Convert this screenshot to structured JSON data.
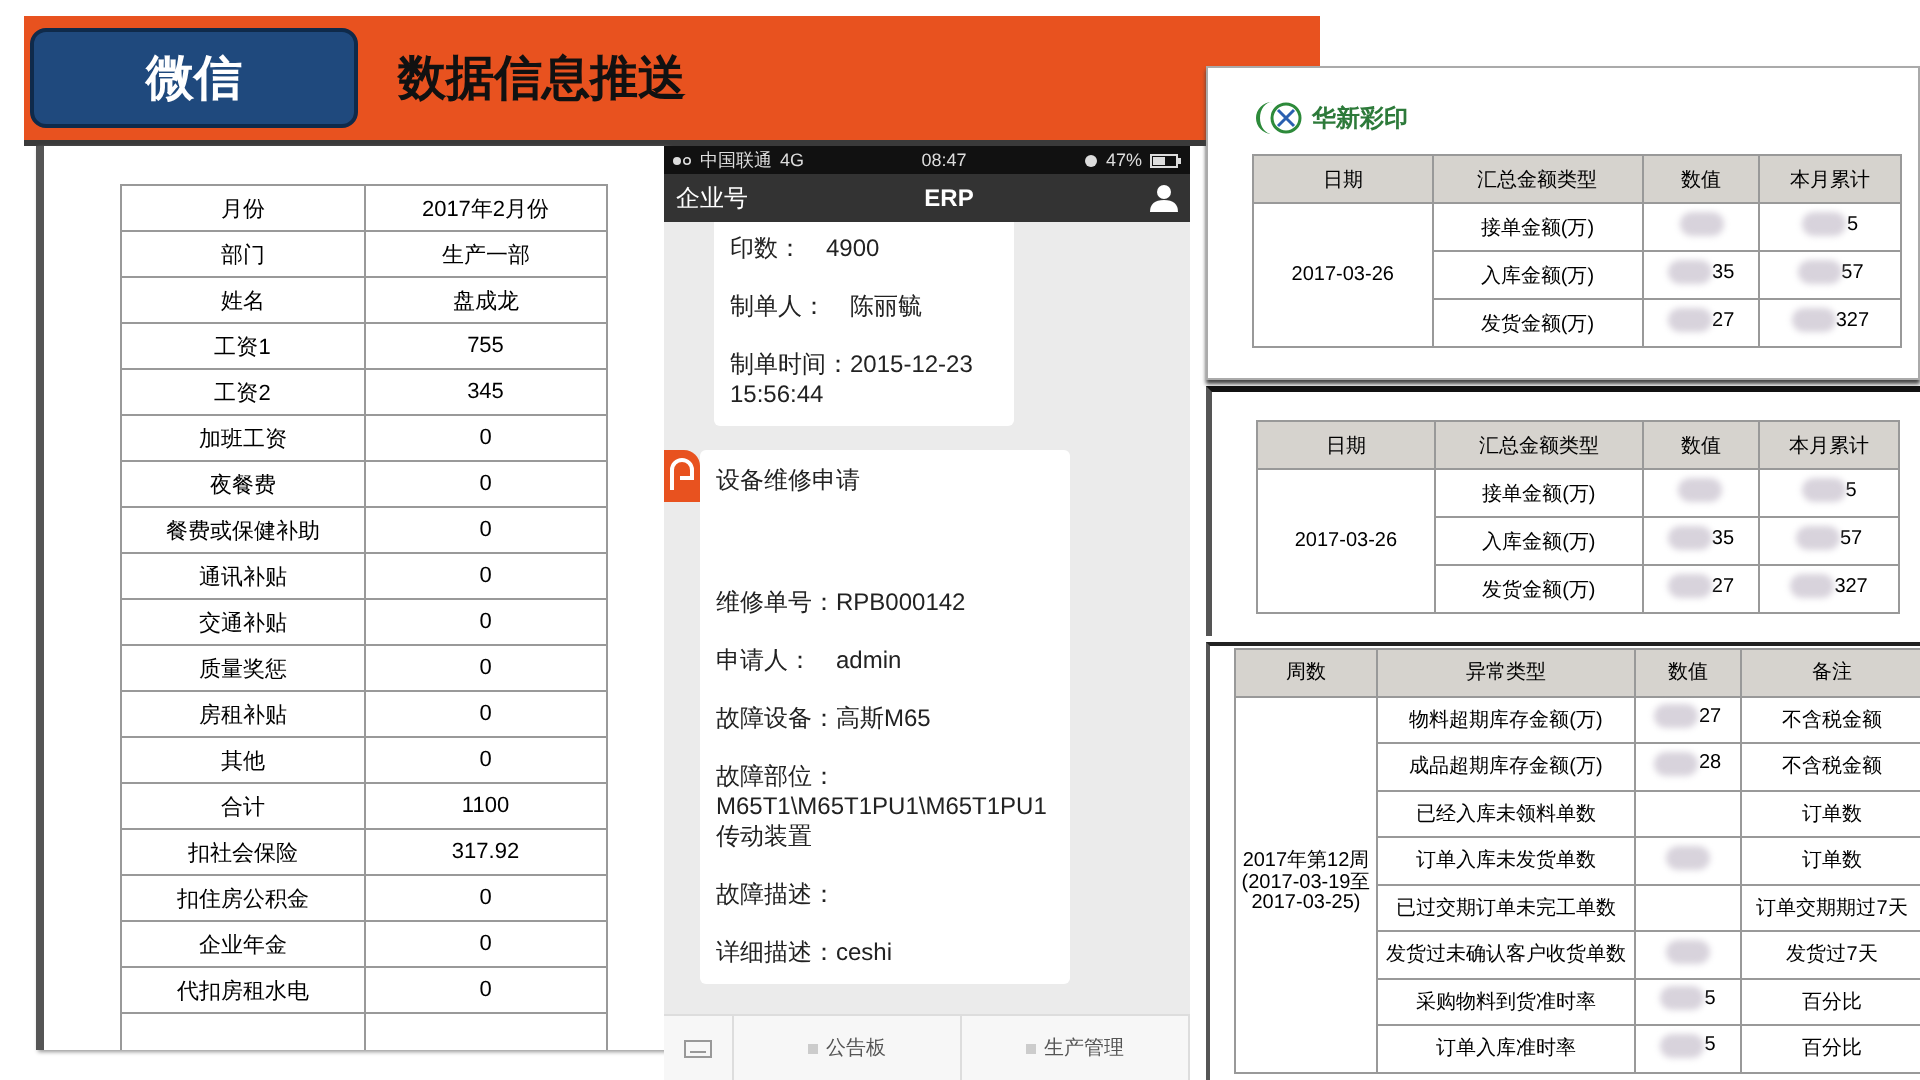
{
  "header": {
    "tab": "微信",
    "title": "数据信息推送"
  },
  "payslip": {
    "rows": [
      {
        "label": "月份",
        "value": "2017年2月份"
      },
      {
        "label": "部门",
        "value": "生产一部"
      },
      {
        "label": "姓名",
        "value": "盘成龙"
      },
      {
        "label": "工资1",
        "value": "755"
      },
      {
        "label": "工资2",
        "value": "345"
      },
      {
        "label": "加班工资",
        "value": "0"
      },
      {
        "label": "夜餐费",
        "value": "0"
      },
      {
        "label": "餐费或保健补助",
        "value": "0"
      },
      {
        "label": "通讯补贴",
        "value": "0"
      },
      {
        "label": "交通补贴",
        "value": "0"
      },
      {
        "label": "质量奖惩",
        "value": "0"
      },
      {
        "label": "房租补贴",
        "value": "0"
      },
      {
        "label": "其他",
        "value": "0"
      },
      {
        "label": "合计",
        "value": "1100"
      },
      {
        "label": "扣社会保险",
        "value": "317.92"
      },
      {
        "label": "扣住房公积金",
        "value": "0"
      },
      {
        "label": "企业年金",
        "value": "0"
      },
      {
        "label": "代扣房租水电",
        "value": "0"
      }
    ]
  },
  "phone": {
    "status": {
      "carrier": "中国联通",
      "network": "4G",
      "time": "08:47",
      "battery": "47%"
    },
    "nav": {
      "back": "企业号",
      "title": "ERP"
    },
    "messages": [
      {
        "avatar": false,
        "lines": [
          "印数：　4900",
          "制单人：　陈丽毓",
          "制单时间：2015-12-23\n15:56:44"
        ]
      },
      {
        "avatar": true,
        "title": "设备维修申请",
        "lines": [
          "维修单号：RPB000142",
          "申请人：　admin",
          "故障设备：高斯M65",
          "故障部位：\nM65T1\\M65T1PU1\\M65T1PU1\n传动装置",
          "故障描述：",
          "详细描述：ceshi"
        ]
      }
    ],
    "tabs": [
      {
        "label": "公告板"
      },
      {
        "label": "生产管理"
      }
    ]
  },
  "summary_reports": [
    {
      "logo": "华新彩印",
      "columns": [
        "日期",
        "汇总金额类型",
        "数值",
        "本月累计"
      ],
      "date": "2017-03-26",
      "rows": [
        {
          "type": "接单金额(万)",
          "value_blurred": true,
          "total": "5",
          "total_blurred": true
        },
        {
          "type": "入库金额(万)",
          "value": "35",
          "value_blurred": true,
          "total": "57",
          "total_blurred": true
        },
        {
          "type": "发货金额(万)",
          "value": "27",
          "value_blurred": true,
          "total": "327",
          "total_blurred": true
        }
      ]
    },
    {
      "columns": [
        "日期",
        "汇总金额类型",
        "数值",
        "本月累计"
      ],
      "date": "2017-03-26",
      "rows": [
        {
          "type": "接单金额(万)",
          "value_blurred": true,
          "total": "5",
          "total_blurred": true
        },
        {
          "type": "入库金额(万)",
          "value": "35",
          "value_blurred": true,
          "total": "57",
          "total_blurred": true
        },
        {
          "type": "发货金额(万)",
          "value": "27",
          "value_blurred": true,
          "total": "327",
          "total_blurred": true
        }
      ]
    }
  ],
  "exception_report": {
    "columns": [
      "周数",
      "异常类型",
      "数值",
      "备注"
    ],
    "week": "2017年第12周\n(2017-03-19至\n2017-03-25)",
    "rows": [
      {
        "type": "物料超期库存金额(万)",
        "value": "27",
        "blurred": true,
        "note": "不含税金额"
      },
      {
        "type": "成品超期库存金额(万)",
        "value": "28",
        "blurred": true,
        "note": "不含税金额"
      },
      {
        "type": "已经入库未领料单数",
        "blurred": false,
        "note": "订单数"
      },
      {
        "type": "订单入库未发货单数",
        "blurred": true,
        "note": "订单数"
      },
      {
        "type": "已过交期订单未完工单数",
        "blurred": false,
        "note": "订单交期期过7天"
      },
      {
        "type": "发货过未确认客户收货单数",
        "blurred": true,
        "note": "发货过7天"
      },
      {
        "type": "采购物料到货准时率",
        "value": "5",
        "blurred": true,
        "note": "百分比"
      },
      {
        "type": "订单入库准时率",
        "value": "5",
        "blurred": true,
        "note": "百分比"
      }
    ]
  }
}
